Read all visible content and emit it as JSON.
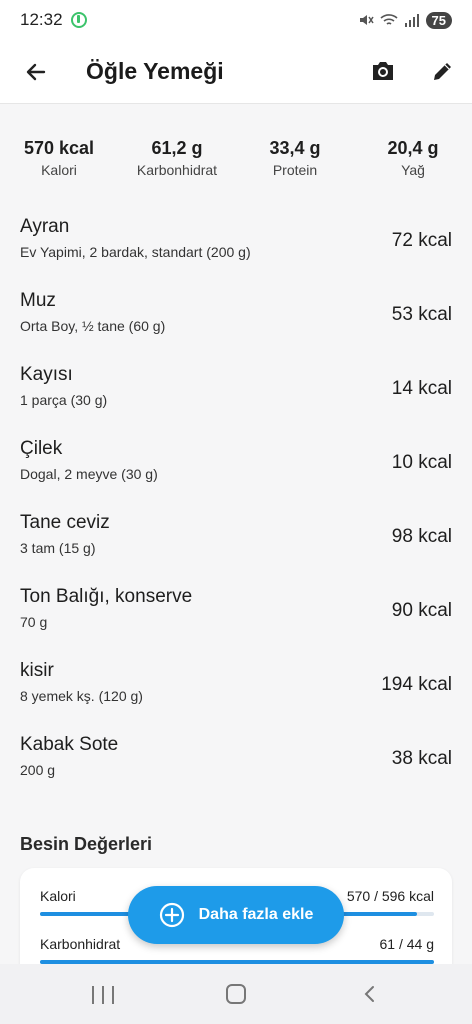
{
  "status": {
    "time": "12:32",
    "battery": "75"
  },
  "header": {
    "title": "Öğle Yemeği"
  },
  "summary": [
    {
      "value": "570 kcal",
      "label": "Kalori"
    },
    {
      "value": "61,2 g",
      "label": "Karbonhidrat"
    },
    {
      "value": "33,4 g",
      "label": "Protein"
    },
    {
      "value": "20,4 g",
      "label": "Yağ"
    }
  ],
  "foods": [
    {
      "name": "Ayran",
      "desc": "Ev Yapimi, 2 bardak, standart (200 g)",
      "kcal": "72 kcal"
    },
    {
      "name": "Muz",
      "desc": "Orta Boy, ½ tane (60 g)",
      "kcal": "53 kcal"
    },
    {
      "name": "Kayısı",
      "desc": "1 parça (30 g)",
      "kcal": "14 kcal"
    },
    {
      "name": "Çilek",
      "desc": "Dogal, 2 meyve (30 g)",
      "kcal": "10 kcal"
    },
    {
      "name": "Tane ceviz",
      "desc": "3 tam (15 g)",
      "kcal": "98 kcal"
    },
    {
      "name": "Ton Balığı, konserve",
      "desc": "70 g",
      "kcal": "90 kcal"
    },
    {
      "name": "kisir",
      "desc": "8 yemek kş.  (120 g)",
      "kcal": "194 kcal"
    },
    {
      "name": "Kabak Sote",
      "desc": "200 g",
      "kcal": "38 kcal"
    }
  ],
  "nutrition": {
    "title": "Besin Değerleri",
    "rows": [
      {
        "label": "Kalori",
        "value": "570 / 596 kcal",
        "progress": 0.956
      },
      {
        "label": "Karbonhidrat",
        "value": "61 / 44 g",
        "progress": 1.0
      }
    ]
  },
  "fab": {
    "label": "Daha fazla ekle"
  },
  "colors": {
    "accent": "#1e9be9",
    "progress": "#1e8fe1"
  }
}
